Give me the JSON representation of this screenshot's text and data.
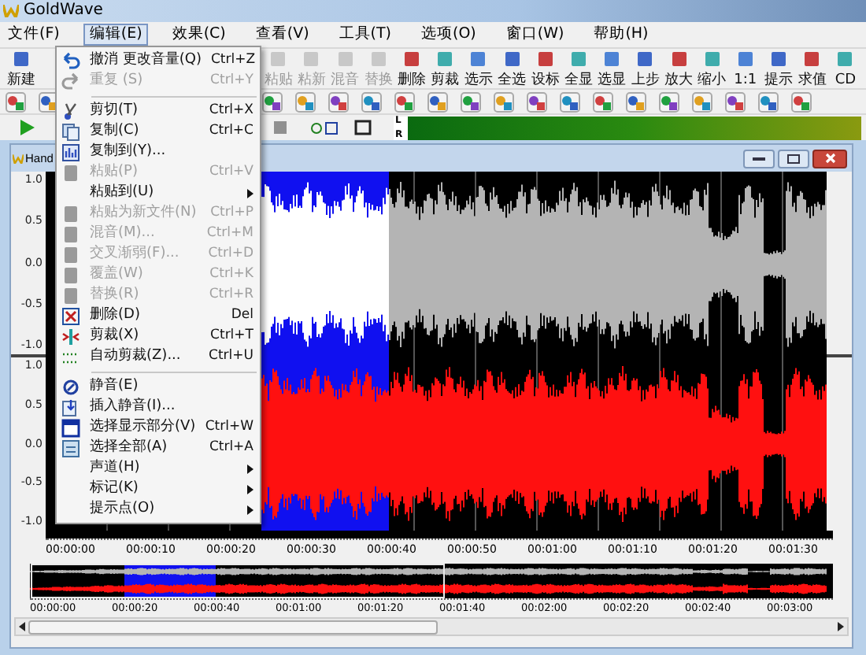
{
  "window": {
    "title": "GoldWave"
  },
  "menu_bar": [
    {
      "label": "文件(F)",
      "selected": false
    },
    {
      "label": "编辑(E)",
      "selected": true
    },
    {
      "label": "效果(C)",
      "selected": false
    },
    {
      "label": "查看(V)",
      "selected": false
    },
    {
      "label": "工具(T)",
      "selected": false
    },
    {
      "label": "选项(O)",
      "selected": false
    },
    {
      "label": "窗口(W)",
      "selected": false
    },
    {
      "label": "帮助(H)",
      "selected": false
    }
  ],
  "toolbar": [
    {
      "label": "新建",
      "disabled": false
    },
    {
      "label": "粘贴",
      "disabled": true
    },
    {
      "label": "粘新",
      "disabled": true
    },
    {
      "label": "混音",
      "disabled": true
    },
    {
      "label": "替换",
      "disabled": true
    },
    {
      "label": "删除",
      "disabled": false
    },
    {
      "label": "剪裁",
      "disabled": false
    },
    {
      "label": "选示",
      "disabled": false
    },
    {
      "label": "全选",
      "disabled": false
    },
    {
      "label": "设标",
      "disabled": false
    },
    {
      "label": "全显",
      "disabled": false
    },
    {
      "label": "选显",
      "disabled": false
    },
    {
      "label": "上步",
      "disabled": false
    },
    {
      "label": "放大",
      "disabled": false
    },
    {
      "label": "缩小",
      "disabled": false
    },
    {
      "label": "1:1",
      "disabled": false
    },
    {
      "label": "提示",
      "disabled": false
    },
    {
      "label": "求值",
      "disabled": false
    },
    {
      "label": "CD",
      "disabled": false
    }
  ],
  "level_meter": {
    "left_label": "L",
    "right_label": "R"
  },
  "edit_menu": [
    {
      "kind": "item",
      "label": "撤消 更改音量(Q)",
      "shortcut": "Ctrl+Z",
      "disabled": false
    },
    {
      "kind": "item",
      "label": "重复 (S)",
      "shortcut": "Ctrl+Y",
      "disabled": true
    },
    {
      "kind": "separator"
    },
    {
      "kind": "item",
      "label": "剪切(T)",
      "shortcut": "Ctrl+X",
      "disabled": false
    },
    {
      "kind": "item",
      "label": "复制(C)",
      "shortcut": "Ctrl+C",
      "disabled": false
    },
    {
      "kind": "item",
      "label": "复制到(Y)...",
      "disabled": false
    },
    {
      "kind": "item",
      "label": "粘贴(P)",
      "shortcut": "Ctrl+V",
      "disabled": true
    },
    {
      "kind": "submenu",
      "label": "粘贴到(U)",
      "disabled": false
    },
    {
      "kind": "item",
      "label": "粘贴为新文件(N)",
      "shortcut": "Ctrl+P",
      "disabled": true
    },
    {
      "kind": "item",
      "label": "混音(M)...",
      "shortcut": "Ctrl+M",
      "disabled": true
    },
    {
      "kind": "item",
      "label": "交叉渐弱(F)...",
      "shortcut": "Ctrl+D",
      "disabled": true
    },
    {
      "kind": "item",
      "label": "覆盖(W)",
      "shortcut": "Ctrl+K",
      "disabled": true
    },
    {
      "kind": "item",
      "label": "替换(R)",
      "shortcut": "Ctrl+R",
      "disabled": true
    },
    {
      "kind": "item",
      "label": "删除(D)",
      "shortcut": "Del",
      "disabled": false
    },
    {
      "kind": "item",
      "label": "剪裁(X)",
      "shortcut": "Ctrl+T",
      "disabled": false
    },
    {
      "kind": "item",
      "label": "自动剪裁(Z)...",
      "shortcut": "Ctrl+U",
      "disabled": false
    },
    {
      "kind": "separator"
    },
    {
      "kind": "item",
      "label": "静音(E)",
      "disabled": false
    },
    {
      "kind": "item",
      "label": "插入静音(I)...",
      "disabled": false
    },
    {
      "kind": "item",
      "label": "选择显示部分(V)",
      "shortcut": "Ctrl+W",
      "disabled": false
    },
    {
      "kind": "item",
      "label": "选择全部(A)",
      "shortcut": "Ctrl+A",
      "disabled": false
    },
    {
      "kind": "submenu",
      "label": "声道(H)",
      "disabled": false
    },
    {
      "kind": "submenu",
      "label": "标记(K)",
      "disabled": false
    },
    {
      "kind": "submenu",
      "label": "提示点(O)",
      "disabled": false
    }
  ],
  "document": {
    "title": "Hand",
    "channels": [
      {
        "color": "#b4b4b4",
        "axis": [
          "1.0",
          "0.5",
          "0.0",
          "-0.5",
          "-1.0"
        ]
      },
      {
        "color": "#ff1010",
        "axis": [
          "1.0",
          "0.5",
          "0.0",
          "-0.5",
          "-1.0"
        ]
      }
    ],
    "timeline": [
      "00:00:00",
      "00:00:10",
      "00:00:20",
      "00:00:30",
      "00:00:40",
      "00:00:50",
      "00:01:00",
      "00:01:10",
      "00:01:20",
      "00:01:30"
    ],
    "overview_timeline": [
      "00:00:00",
      "00:00:20",
      "00:00:40",
      "00:01:00",
      "00:01:20",
      "00:01:40",
      "00:02:00",
      "00:02:20",
      "00:02:40",
      "00:03:00"
    ]
  }
}
